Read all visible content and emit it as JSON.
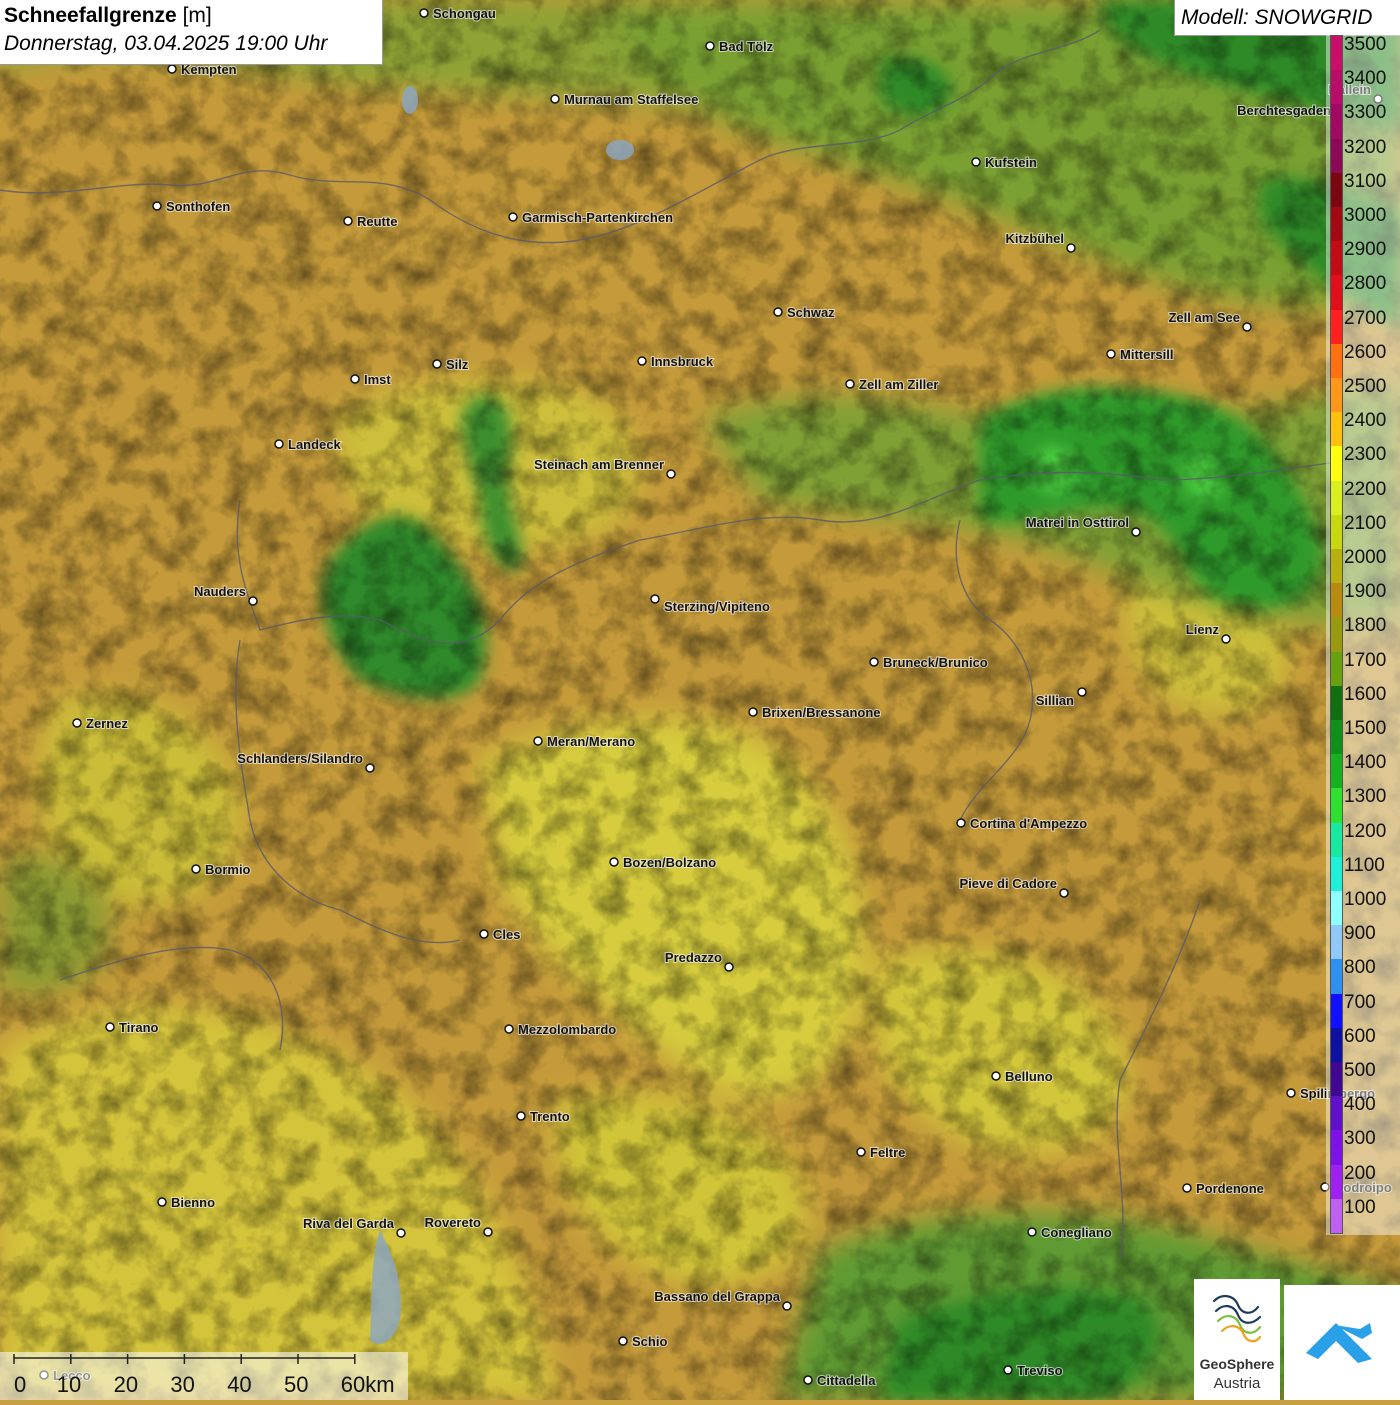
{
  "title": {
    "main": "Schneefallgrenze",
    "unit": "[m]",
    "datetime": "Donnerstag, 03.04.2025 19:00 Uhr"
  },
  "model": {
    "label": "Modell: SNOWGRID"
  },
  "legend": {
    "levels": [
      {
        "value": "3500",
        "color": "#c8106a"
      },
      {
        "value": "3400",
        "color": "#b80d68"
      },
      {
        "value": "3300",
        "color": "#a00a60"
      },
      {
        "value": "3200",
        "color": "#8a0a55"
      },
      {
        "value": "3100",
        "color": "#7a0810"
      },
      {
        "value": "3000",
        "color": "#a00a10"
      },
      {
        "value": "2900",
        "color": "#c20c14"
      },
      {
        "value": "2800",
        "color": "#e0101a"
      },
      {
        "value": "2700",
        "color": "#ff2020"
      },
      {
        "value": "2600",
        "color": "#ff7010"
      },
      {
        "value": "2500",
        "color": "#ff9818"
      },
      {
        "value": "2400",
        "color": "#ffc010"
      },
      {
        "value": "2300",
        "color": "#ffff10"
      },
      {
        "value": "2200",
        "color": "#d8f020"
      },
      {
        "value": "2100",
        "color": "#c8d810"
      },
      {
        "value": "2000",
        "color": "#b8b010"
      },
      {
        "value": "1900",
        "color": "#b88a10"
      },
      {
        "value": "1800",
        "color": "#9a9a10"
      },
      {
        "value": "1700",
        "color": "#68a010"
      },
      {
        "value": "1600",
        "color": "#107010"
      },
      {
        "value": "1500",
        "color": "#10901a"
      },
      {
        "value": "1400",
        "color": "#18b020"
      },
      {
        "value": "1300",
        "color": "#30e030"
      },
      {
        "value": "1200",
        "color": "#18e8a0"
      },
      {
        "value": "1100",
        "color": "#20f0d8"
      },
      {
        "value": "1000",
        "color": "#90ffff"
      },
      {
        "value": "900",
        "color": "#90c8f8"
      },
      {
        "value": "800",
        "color": "#3090f0"
      },
      {
        "value": "700",
        "color": "#1010ff"
      },
      {
        "value": "600",
        "color": "#1010a0"
      },
      {
        "value": "500",
        "color": "#400890"
      },
      {
        "value": "400",
        "color": "#6010c8"
      },
      {
        "value": "300",
        "color": "#8010e8"
      },
      {
        "value": "200",
        "color": "#a020f0"
      },
      {
        "value": "100",
        "color": "#c060f0"
      }
    ]
  },
  "scale_bar": {
    "ticks": [
      "0",
      "10",
      "20",
      "30",
      "40",
      "50",
      "60km"
    ]
  },
  "cities": [
    {
      "name": "Schongau"
    },
    {
      "name": "Bad Tölz"
    },
    {
      "name": "Kempten"
    },
    {
      "name": "Murnau am Staffelsee"
    },
    {
      "name": "Berchtesgaden"
    },
    {
      "name": "Hallein"
    },
    {
      "name": "Kufstein"
    },
    {
      "name": "Sonthofen"
    },
    {
      "name": "Reutte"
    },
    {
      "name": "Garmisch-Partenkirchen"
    },
    {
      "name": "Kitzbühel"
    },
    {
      "name": "Schwaz"
    },
    {
      "name": "Zell am See"
    },
    {
      "name": "Innsbruck"
    },
    {
      "name": "Mittersill"
    },
    {
      "name": "Silz"
    },
    {
      "name": "Imst"
    },
    {
      "name": "Zell am Ziller"
    },
    {
      "name": "Landeck"
    },
    {
      "name": "Steinach am Brenner"
    },
    {
      "name": "Matrei in Osttirol"
    },
    {
      "name": "Nauders"
    },
    {
      "name": "Sterzing/Vipiteno"
    },
    {
      "name": "Lienz"
    },
    {
      "name": "Bruneck/Brunico"
    },
    {
      "name": "Sillian"
    },
    {
      "name": "Zernez"
    },
    {
      "name": "Brixen/Bressanone"
    },
    {
      "name": "Meran/Merano"
    },
    {
      "name": "Schlanders/Silandro"
    },
    {
      "name": "Cortina d'Ampezzo"
    },
    {
      "name": "Bormio"
    },
    {
      "name": "Bozen/Bolzano"
    },
    {
      "name": "Pieve di Cadore"
    },
    {
      "name": "Cles"
    },
    {
      "name": "Predazzo"
    },
    {
      "name": "Tirano"
    },
    {
      "name": "Mezzolombardo"
    },
    {
      "name": "Belluno"
    },
    {
      "name": "Spilimbergo"
    },
    {
      "name": "Trento"
    },
    {
      "name": "Feltre"
    },
    {
      "name": "Pordenone"
    },
    {
      "name": "Codroipo"
    },
    {
      "name": "Bienno"
    },
    {
      "name": "Riva del Garda"
    },
    {
      "name": "Rovereto"
    },
    {
      "name": "Conegliano"
    },
    {
      "name": "Bassano del Grappa"
    },
    {
      "name": "Schio"
    },
    {
      "name": "Treviso"
    },
    {
      "name": "Cittadella"
    },
    {
      "name": "Lecco"
    }
  ],
  "logos": {
    "geosphere_line1": "GeoSphere",
    "geosphere_line2": "Austria"
  }
}
